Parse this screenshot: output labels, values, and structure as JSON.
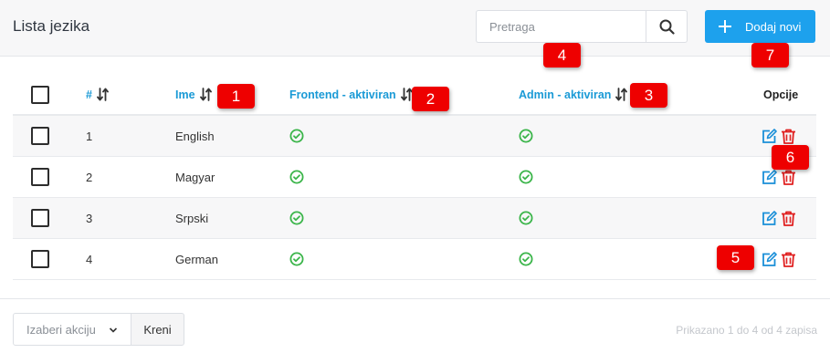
{
  "header": {
    "title": "Lista jezika",
    "search_placeholder": "Pretraga",
    "add_button": "Dodaj novi"
  },
  "table": {
    "columns": {
      "number": "#",
      "name": "Ime",
      "frontend": "Frontend - aktiviran",
      "admin": "Admin - aktiviran",
      "options": "Opcije"
    },
    "rows": [
      {
        "id": "1",
        "name": "English",
        "frontend_active": true,
        "admin_active": true
      },
      {
        "id": "2",
        "name": "Magyar",
        "frontend_active": true,
        "admin_active": true
      },
      {
        "id": "3",
        "name": "Srpski",
        "frontend_active": true,
        "admin_active": true
      },
      {
        "id": "4",
        "name": "German",
        "frontend_active": true,
        "admin_active": true
      }
    ]
  },
  "footer": {
    "action_placeholder": "Izaberi akciju",
    "go_button": "Kreni",
    "summary": "Prikazano 1 do 4 od 4 zapisa"
  },
  "badges": [
    "1",
    "2",
    "3",
    "4",
    "5",
    "6",
    "7"
  ],
  "colors": {
    "accent": "#1da1ed",
    "header_link": "#1a9ad6",
    "success": "#3bb54a",
    "danger": "#e02020",
    "badge": "#ee0000"
  },
  "icons": {
    "search": "search-icon",
    "add": "plus-icon",
    "sort": "sort-icon",
    "active": "check-circle-icon",
    "edit": "edit-icon",
    "delete": "trash-icon",
    "dropdown": "chevron-down-icon"
  }
}
